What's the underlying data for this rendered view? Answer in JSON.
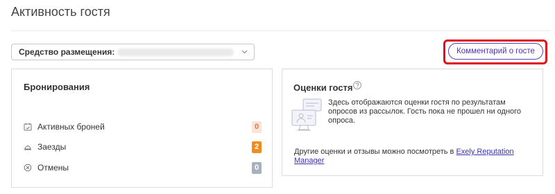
{
  "page": {
    "title": "Активность гостя"
  },
  "property_select": {
    "label": "Средство размещения:",
    "value": ""
  },
  "comment_button": {
    "label": "Комментарий о госте"
  },
  "bookings": {
    "title": "Бронирования",
    "rows": [
      {
        "label": "Активных броней",
        "count": "0",
        "icon": "calendar-check-icon"
      },
      {
        "label": "Заезды",
        "count": "2",
        "icon": "reception-bell-icon"
      },
      {
        "label": "Отмены",
        "count": "0",
        "icon": "cancel-circle-icon"
      }
    ]
  },
  "ratings": {
    "title": "Оценки гостя",
    "help_icon": "question-circle-icon",
    "survey_text": "Здесь отображаются оценки гостя по результатам опросов из рассылок. Гость пока не прошел ни одного опроса.",
    "other_prefix": "Другие оценки и отзывы можно посмотреть в ",
    "other_link": "Exely Reputation Manager"
  },
  "colors": {
    "accent": "#4a36a8",
    "highlight": "#e0101a",
    "badge_active_bg": "#fbe3d8",
    "badge_arrivals_bg": "#f28c1c",
    "badge_cancel_bg": "#a7b0bd"
  }
}
